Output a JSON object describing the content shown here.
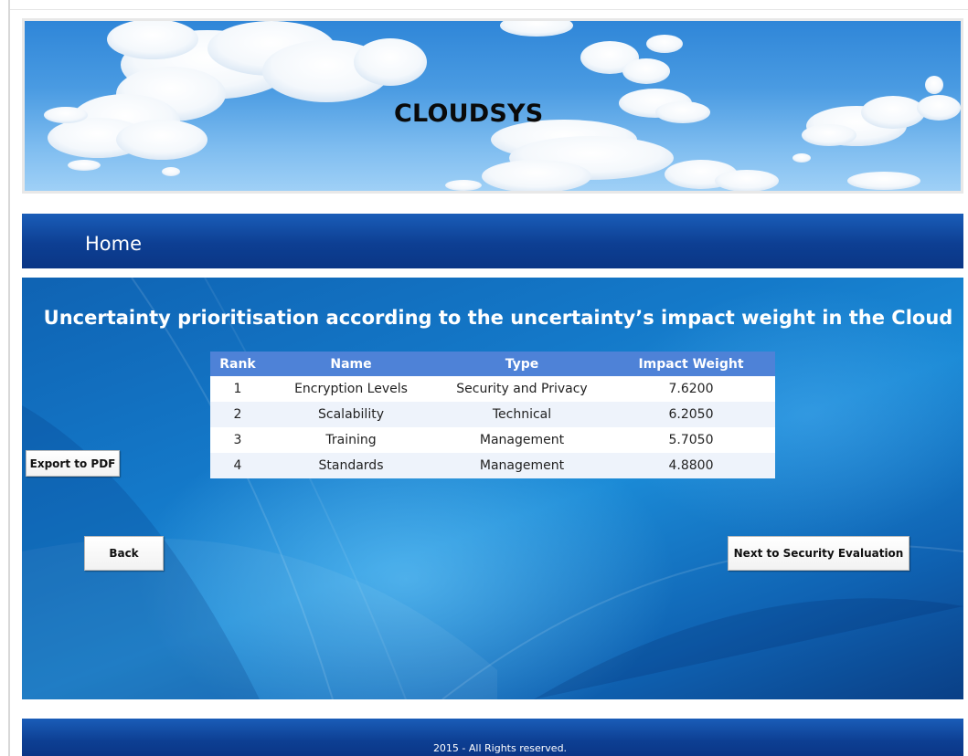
{
  "banner": {
    "title": "CLOUDSYS"
  },
  "nav": {
    "home_label": "Home"
  },
  "main": {
    "heading": "Uncertainty prioritisation according to the uncertainty’s impact weight in the Cloud",
    "table": {
      "headers": [
        "Rank",
        "Name",
        "Type",
        "Impact Weight"
      ],
      "rows": [
        [
          "1",
          "Encryption Levels",
          "Security and Privacy",
          "7.6200"
        ],
        [
          "2",
          "Scalability",
          "Technical",
          "6.2050"
        ],
        [
          "3",
          "Training",
          "Management",
          "5.7050"
        ],
        [
          "4",
          "Standards",
          "Management",
          "4.8800"
        ]
      ]
    },
    "buttons": {
      "export_label": "Export to PDF",
      "back_label": "Back",
      "next_label": "Next to Security Evaluation"
    }
  },
  "footer": {
    "text": "2015 - All Rights reserved."
  },
  "colors": {
    "nav_blue": "#0d3f93",
    "table_header": "#4e82d7",
    "table_row_alt": "#eef3fb"
  },
  "icons": {
    "banner": "sky-clouds-image"
  }
}
